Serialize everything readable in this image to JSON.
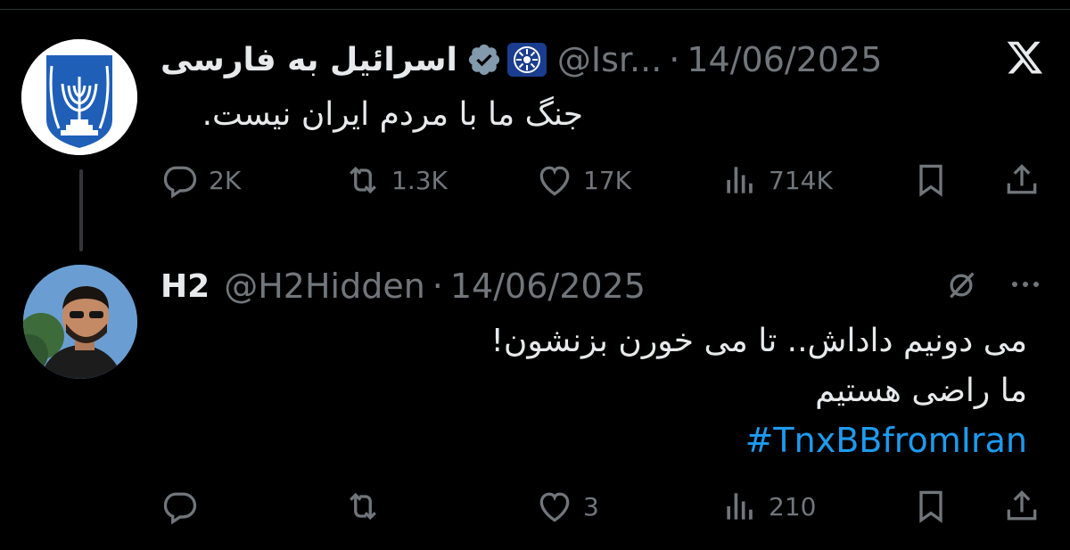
{
  "tweet1": {
    "display_name": "اسرائیل به فارسی",
    "handle": "@Isr...",
    "separator": "·",
    "date": "14/06/2025",
    "text": "جنگ ما با مردم ایران نیست.",
    "stats": {
      "replies": "2K",
      "reposts": "1.3K",
      "likes": "17K",
      "views": "714K"
    }
  },
  "tweet2": {
    "display_name": "H2",
    "handle": "@H2Hidden",
    "separator": "·",
    "date": "14/06/2025",
    "text_line1": "می دونیم داداش.. تا می خورن بزنشون!",
    "text_line2": "ما راضی هستیم",
    "hashtag": "#TnxBBfromIran",
    "stats": {
      "replies": "",
      "reposts": "",
      "likes": "3",
      "views": "210"
    }
  },
  "icons": [
    "x-logo-icon",
    "verified-badge-icon",
    "government-badge-icon",
    "reply-icon",
    "repost-icon",
    "like-icon",
    "views-icon",
    "bookmark-icon",
    "share-icon",
    "grok-icon",
    "more-icon"
  ],
  "colors": {
    "background": "#000000",
    "text": "#e7e9ea",
    "muted": "#71767b",
    "link": "#1d9bf0",
    "thread_line": "#333639"
  }
}
